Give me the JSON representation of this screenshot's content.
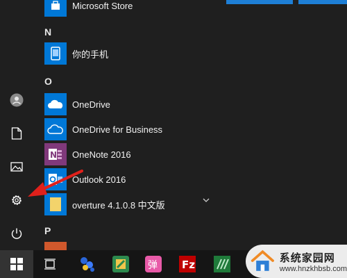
{
  "rail": {
    "items": [
      {
        "name": "user-icon"
      },
      {
        "name": "documents-icon"
      },
      {
        "name": "pictures-icon"
      },
      {
        "name": "settings-icon"
      },
      {
        "name": "power-icon"
      }
    ]
  },
  "app_list": {
    "microsoft_store": "Microsoft Store",
    "group_n": "N",
    "phone_app": "你的手机",
    "group_o": "O",
    "onedrive": "OneDrive",
    "onedrive_business": "OneDrive for Business",
    "onenote": "OneNote 2016",
    "outlook": "Outlook 2016",
    "overture": "overture 4.1.0.8 中文版",
    "group_p": "P"
  },
  "taskbar": {
    "icons": [
      "start-icon",
      "task-view-icon",
      "app-icon-1",
      "app-icon-2",
      "danmaku-app-icon",
      "filezilla-icon",
      "app-icon-3"
    ]
  },
  "watermark": {
    "site_name": "系统家园网",
    "url": "www.hnzkhbsb.com"
  },
  "colors": {
    "tile_blue": "#0078d7",
    "onenote_purple": "#80397b",
    "arrow_red": "#e0201b"
  }
}
